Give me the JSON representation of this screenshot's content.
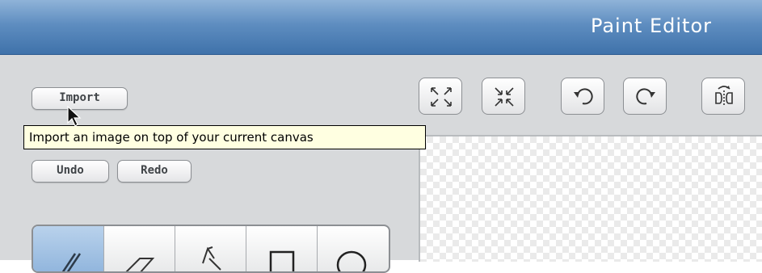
{
  "window": {
    "title": "Paint Editor"
  },
  "buttons": {
    "import": "Import",
    "undo": "Undo",
    "redo": "Redo"
  },
  "tooltip": {
    "text": "Import an image on top of your current canvas"
  },
  "toolbar_icons": [
    "grow-icon",
    "shrink-icon",
    "rotate-left-icon",
    "rotate-right-icon",
    "flip-horizontal-icon"
  ],
  "tools": [
    "paintbrush-icon",
    "eraser-icon",
    "fill-bucket-icon",
    "rectangle-icon",
    "ellipse-icon"
  ],
  "colors": {
    "titlebar": "#5e8dc0",
    "panel": "#d7d9db",
    "tooltip": "#ffffe1",
    "selected_tool": "#9fc0e2"
  }
}
